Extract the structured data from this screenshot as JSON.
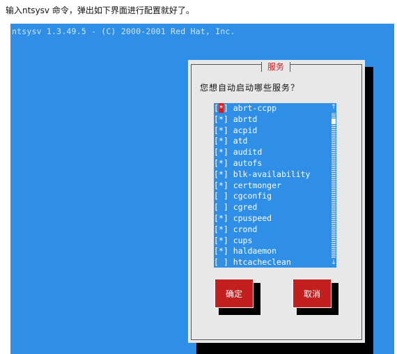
{
  "caption": "输入ntsysv 命令，弹出如下界面进行配置就好了。",
  "terminal": {
    "header": "ntsysv 1.3.49.5 - (C) 2000-2001 Red Hat, Inc."
  },
  "dialog": {
    "title": "服务",
    "prompt": "您想自动启动哪些服务？",
    "services": [
      {
        "checkbox": "[*]",
        "name": "abrt-ccpp"
      },
      {
        "checkbox": "[*]",
        "name": "abrtd"
      },
      {
        "checkbox": "[*]",
        "name": "acpid"
      },
      {
        "checkbox": "[*]",
        "name": "atd"
      },
      {
        "checkbox": "[*]",
        "name": "auditd"
      },
      {
        "checkbox": "[*]",
        "name": "autofs"
      },
      {
        "checkbox": "[*]",
        "name": "blk-availability"
      },
      {
        "checkbox": "[*]",
        "name": "certmonger"
      },
      {
        "checkbox": "[ ]",
        "name": "cgconfig"
      },
      {
        "checkbox": "[ ]",
        "name": "cgred"
      },
      {
        "checkbox": "[*]",
        "name": "cpuspeed"
      },
      {
        "checkbox": "[*]",
        "name": "crond"
      },
      {
        "checkbox": "[*]",
        "name": "cups"
      },
      {
        "checkbox": "[*]",
        "name": "haldaemon"
      },
      {
        "checkbox": "[ ]",
        "name": "htcacheclean"
      }
    ],
    "scroll_up": "↑",
    "scroll_down": "↓",
    "ok_label": "确定",
    "cancel_label": "取消"
  },
  "colors": {
    "terminal_bg": "#2f8ee6",
    "dialog_bg": "#e8e8e8",
    "button_bg": "#c21f1f",
    "title_text": "#c62020"
  }
}
